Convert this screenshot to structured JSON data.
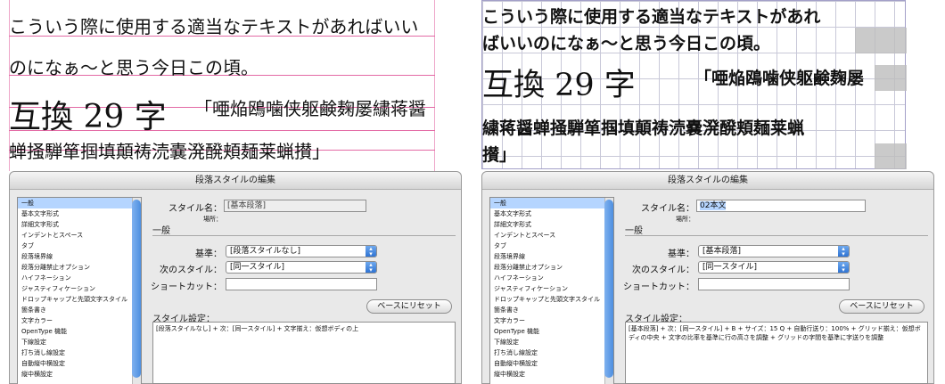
{
  "left": {
    "sample": {
      "line1": "こういう際に使用する適当なテキストがあればいい",
      "line2": "のになぁ〜と思う今日この頃。",
      "line3_big": "互換 29 字",
      "line3_small": "「唖焔鴎噛侠躯鹸麹屡繍蒋醤",
      "line4": "蝉掻騨箪掴填顛祷涜嚢溌醗頬麺莱蝋攅」"
    },
    "dialog": {
      "title": "段落スタイルの編集",
      "sidebar": [
        "一般",
        "基本文字形式",
        "詳細文字形式",
        "インデントとスペース",
        "タブ",
        "段落境界線",
        "段落分離禁止オプション",
        "ハイフネーション",
        "ジャスティフィケーション",
        "ドロップキャップと先頭文字スタイル",
        "箇条書き",
        "文字カラー",
        "OpenType 機能",
        "下線設定",
        "打ち消し線設定",
        "自動縦中横設定",
        "縦中横設定"
      ],
      "style_name_label": "スタイル名：",
      "style_name_value": "[基本段落]",
      "location_label": "場所：",
      "general_section": "一般",
      "based_on_label": "基準：",
      "based_on_value": "[段落スタイルなし]",
      "next_style_label": "次のスタイル：",
      "next_style_value": "[同一スタイル]",
      "shortcut_label": "ショートカット：",
      "shortcut_value": "",
      "reset_button": "ベースにリセット",
      "settings_label": "スタイル設定：",
      "settings_text": "[段落スタイルなし] + 次：[同一スタイル] + 文字揃え：仮想ボディの上"
    }
  },
  "right": {
    "sample": {
      "line1": "こういう際に使用する適当なテキストがあれ",
      "line2": "ばいいのになぁ〜と思う今日この頃。",
      "line3_big": "互換 29 字",
      "line3_small": "「唖焔鴎噛侠躯鹸麹屡",
      "line4": "繍蒋醤蝉掻騨箪掴填顛祷涜嚢溌醗頬麺莱蝋",
      "line5": "攅」"
    },
    "dialog": {
      "title": "段落スタイルの編集",
      "sidebar": [
        "一般",
        "基本文字形式",
        "詳細文字形式",
        "インデントとスペース",
        "タブ",
        "段落境界線",
        "段落分離禁止オプション",
        "ハイフネーション",
        "ジャスティフィケーション",
        "ドロップキャップと先頭文字スタイル",
        "箇条書き",
        "文字カラー",
        "OpenType 機能",
        "下線設定",
        "打ち消し線設定",
        "自動縦中横設定",
        "縦中横設定"
      ],
      "style_name_label": "スタイル名：",
      "style_name_value": "02本文",
      "location_label": "場所：",
      "general_section": "一般",
      "based_on_label": "基準：",
      "based_on_value": "[基本段落]",
      "next_style_label": "次のスタイル：",
      "next_style_value": "[同一スタイル]",
      "shortcut_label": "ショートカット：",
      "shortcut_value": "",
      "reset_button": "ベースにリセット",
      "settings_label": "スタイル設定：",
      "settings_text": "[基本段落] + 次：[同一スタイル] + B + サイズ：15 Q + 自動行送り：100% + グリッド揃え：仮想ボディの中央 + 文字の比率を基準に行の高さを調整 + グリッドの字間を基準に字送りを調整"
    }
  },
  "colors": {
    "guide": "#e36aa5",
    "selection": "#b5d5ff",
    "accent": "#2f74d3"
  }
}
